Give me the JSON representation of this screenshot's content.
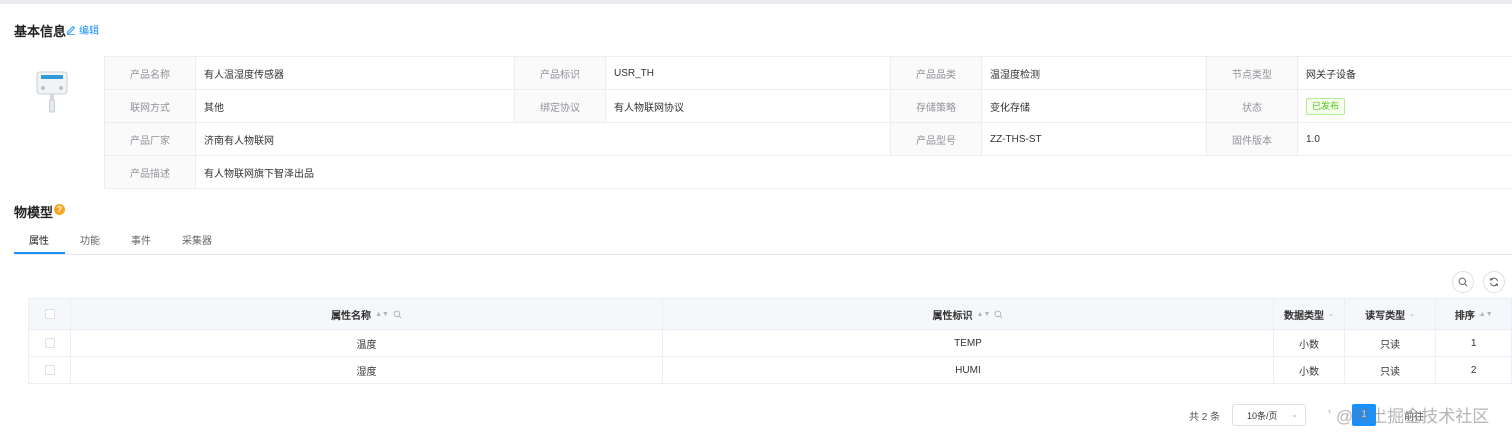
{
  "basic_info": {
    "title": "基本信息",
    "edit_label": "编辑",
    "fields": {
      "product_name": {
        "label": "产品名称",
        "value": "有人温湿度传感器"
      },
      "product_key": {
        "label": "产品标识",
        "value": "USR_TH"
      },
      "category": {
        "label": "产品品类",
        "value": "温湿度检测"
      },
      "node_type": {
        "label": "节点类型",
        "value": "网关子设备"
      },
      "network": {
        "label": "联网方式",
        "value": "其他"
      },
      "protocol": {
        "label": "绑定协议",
        "value": "有人物联网协议"
      },
      "storage": {
        "label": "存储策略",
        "value": "变化存储"
      },
      "status": {
        "label": "状态",
        "value": "已发布"
      },
      "vendor": {
        "label": "产品厂家",
        "value": "济南有人物联网"
      },
      "model": {
        "label": "产品型号",
        "value": "ZZ-THS-ST"
      },
      "firmware": {
        "label": "固件版本",
        "value": "1.0"
      },
      "description": {
        "label": "产品描述",
        "value": "有人物联网旗下智泽出品"
      }
    }
  },
  "thing_model": {
    "title": "物模型",
    "help_icon": "?",
    "tabs": [
      {
        "label": "属性"
      },
      {
        "label": "功能"
      },
      {
        "label": "事件"
      },
      {
        "label": "采集器"
      }
    ],
    "table": {
      "columns": [
        "属性名称",
        "属性标识",
        "数据类型",
        "读写类型",
        "排序"
      ],
      "rows": [
        {
          "name": "温度",
          "key": "TEMP",
          "data_type": "小数",
          "rw": "只读",
          "sort": "1"
        },
        {
          "name": "湿度",
          "key": "HUMI",
          "data_type": "小数",
          "rw": "只读",
          "sort": "2"
        }
      ]
    }
  },
  "pager": {
    "total": "共 2 条",
    "page_size": "10条/页",
    "current_page": "1",
    "jump_label": "前往"
  },
  "watermark": "@稀土掘金技术社区",
  "colors": {
    "accent": "#1890ff",
    "status_green": "#52c41a",
    "help": "#f5a623"
  },
  "icons": [
    "edit-icon",
    "help-icon",
    "search-icon",
    "refresh-icon",
    "sort-icon",
    "filter-search-icon",
    "chevron-down-icon"
  ]
}
